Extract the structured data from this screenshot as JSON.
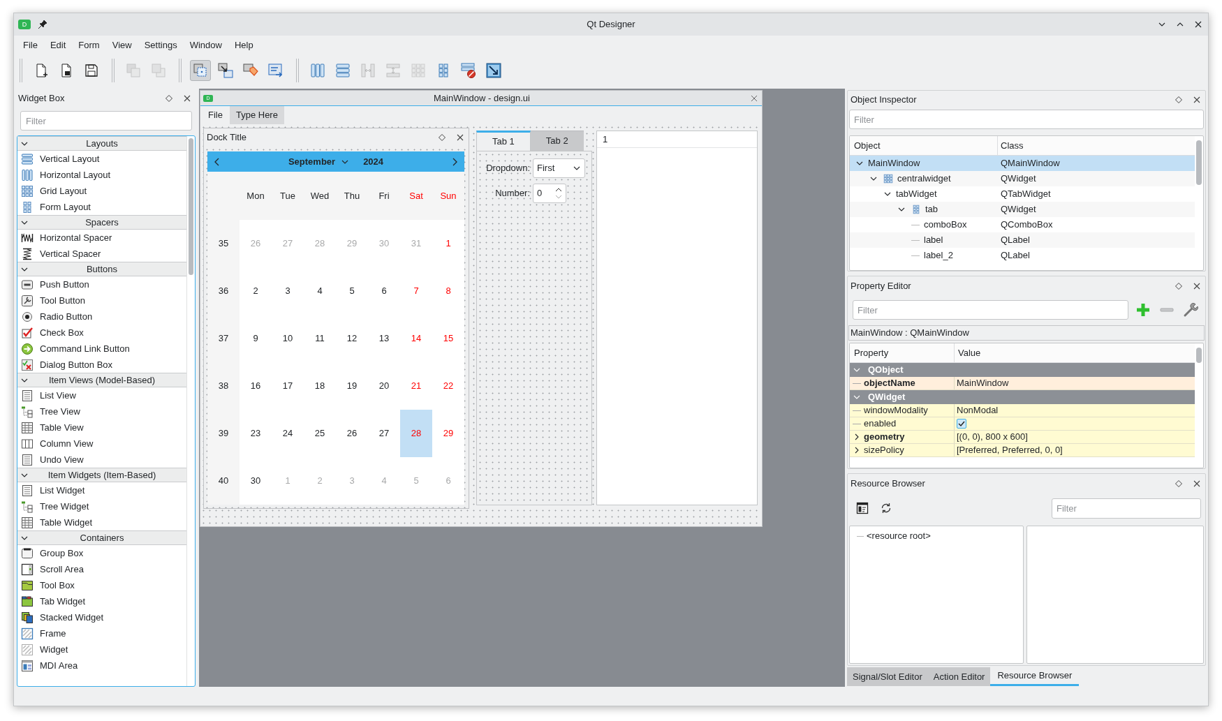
{
  "window": {
    "logo": "D",
    "title": "Qt Designer"
  },
  "menu": [
    "File",
    "Edit",
    "Form",
    "View",
    "Settings",
    "Window",
    "Help"
  ],
  "toolbar_groups": [
    {
      "items": [
        {
          "kind": "new",
          "disabled": false,
          "selected": false
        },
        {
          "kind": "open",
          "disabled": false,
          "selected": false
        },
        {
          "kind": "save",
          "disabled": false,
          "selected": false
        }
      ]
    },
    {
      "items": [
        {
          "kind": "front",
          "disabled": true,
          "selected": false
        },
        {
          "kind": "back",
          "disabled": true,
          "selected": false
        }
      ]
    },
    {
      "items": [
        {
          "kind": "editwidgets",
          "disabled": false,
          "selected": true
        },
        {
          "kind": "signals",
          "disabled": false,
          "selected": false
        },
        {
          "kind": "buddies",
          "disabled": false,
          "selected": false
        },
        {
          "kind": "taborder",
          "disabled": false,
          "selected": false
        }
      ]
    },
    {
      "items": [
        {
          "kind": "hlayout",
          "disabled": false,
          "selected": false
        },
        {
          "kind": "vlayout",
          "disabled": false,
          "selected": false
        },
        {
          "kind": "hsplitter",
          "disabled": true,
          "selected": false
        },
        {
          "kind": "vsplitter",
          "disabled": true,
          "selected": false
        },
        {
          "kind": "grid",
          "disabled": true,
          "selected": false
        },
        {
          "kind": "form",
          "disabled": false,
          "selected": false
        },
        {
          "kind": "breaklayout",
          "disabled": false,
          "selected": false
        },
        {
          "kind": "adjustsize",
          "disabled": false,
          "selected": false
        }
      ]
    }
  ],
  "widget_box": {
    "title": "Widget Box",
    "filter_placeholder": "Filter",
    "categories": [
      {
        "label": "Layouts",
        "expanded": true,
        "items": [
          {
            "label": "Vertical Layout",
            "kind": "vlayout"
          },
          {
            "label": "Horizontal Layout",
            "kind": "hlayout"
          },
          {
            "label": "Grid Layout",
            "kind": "grid"
          },
          {
            "label": "Form Layout",
            "kind": "form"
          }
        ]
      },
      {
        "label": "Spacers",
        "expanded": true,
        "items": [
          {
            "label": "Horizontal Spacer",
            "kind": "hspacer"
          },
          {
            "label": "Vertical Spacer",
            "kind": "vspacer"
          }
        ]
      },
      {
        "label": "Buttons",
        "expanded": true,
        "items": [
          {
            "label": "Push Button",
            "kind": "pushbutton"
          },
          {
            "label": "Tool Button",
            "kind": "toolbutton"
          },
          {
            "label": "Radio Button",
            "kind": "radio"
          },
          {
            "label": "Check Box",
            "kind": "checkbox"
          },
          {
            "label": "Command Link Button",
            "kind": "commandlink"
          },
          {
            "label": "Dialog Button Box",
            "kind": "buttonbox"
          }
        ]
      },
      {
        "label": "Item Views (Model-Based)",
        "expanded": true,
        "items": [
          {
            "label": "List View",
            "kind": "listview"
          },
          {
            "label": "Tree View",
            "kind": "treeview"
          },
          {
            "label": "Table View",
            "kind": "tableview"
          },
          {
            "label": "Column View",
            "kind": "columnview"
          },
          {
            "label": "Undo View",
            "kind": "listview"
          }
        ]
      },
      {
        "label": "Item Widgets (Item-Based)",
        "expanded": true,
        "items": [
          {
            "label": "List Widget",
            "kind": "listview"
          },
          {
            "label": "Tree Widget",
            "kind": "treeview"
          },
          {
            "label": "Table Widget",
            "kind": "tableview"
          }
        ]
      },
      {
        "label": "Containers",
        "expanded": true,
        "items": [
          {
            "label": "Group Box",
            "kind": "groupbox"
          },
          {
            "label": "Scroll Area",
            "kind": "scrollarea"
          },
          {
            "label": "Tool Box",
            "kind": "toolbox"
          },
          {
            "label": "Tab Widget",
            "kind": "tabwidget"
          },
          {
            "label": "Stacked Widget",
            "kind": "stacked"
          },
          {
            "label": "Frame",
            "kind": "frame"
          },
          {
            "label": "Widget",
            "kind": "widget"
          },
          {
            "label": "MDI Area",
            "kind": "mdi"
          }
        ]
      }
    ]
  },
  "form_window": {
    "logo": "D",
    "title": "MainWindow - design.ui",
    "menu": [
      {
        "label": "File",
        "kind": "menu"
      },
      {
        "label": "Type Here",
        "kind": "placeholder"
      }
    ],
    "dock": {
      "title": "Dock Title",
      "calendar": {
        "month": "September",
        "year": "2024",
        "weekdays": [
          {
            "label": "Mon",
            "weekend": false
          },
          {
            "label": "Tue",
            "weekend": false
          },
          {
            "label": "Wed",
            "weekend": false
          },
          {
            "label": "Thu",
            "weekend": false
          },
          {
            "label": "Fri",
            "weekend": false
          },
          {
            "label": "Sat",
            "weekend": true
          },
          {
            "label": "Sun",
            "weekend": true
          }
        ],
        "weeks": [
          {
            "number": "35",
            "days": [
              {
                "day": "26",
                "outside": true,
                "selected": false
              },
              {
                "day": "27",
                "outside": true,
                "selected": false
              },
              {
                "day": "28",
                "outside": true,
                "selected": false
              },
              {
                "day": "29",
                "outside": true,
                "selected": false
              },
              {
                "day": "30",
                "outside": true,
                "selected": false
              },
              {
                "day": "31",
                "outside": true,
                "selected": false
              },
              {
                "day": "1",
                "outside": false,
                "selected": false
              }
            ]
          },
          {
            "number": "36",
            "days": [
              {
                "day": "2",
                "outside": false,
                "selected": false
              },
              {
                "day": "3",
                "outside": false,
                "selected": false
              },
              {
                "day": "4",
                "outside": false,
                "selected": false
              },
              {
                "day": "5",
                "outside": false,
                "selected": false
              },
              {
                "day": "6",
                "outside": false,
                "selected": false
              },
              {
                "day": "7",
                "outside": false,
                "selected": false
              },
              {
                "day": "8",
                "outside": false,
                "selected": false
              }
            ]
          },
          {
            "number": "37",
            "days": [
              {
                "day": "9",
                "outside": false,
                "selected": false
              },
              {
                "day": "10",
                "outside": false,
                "selected": false
              },
              {
                "day": "11",
                "outside": false,
                "selected": false
              },
              {
                "day": "12",
                "outside": false,
                "selected": false
              },
              {
                "day": "13",
                "outside": false,
                "selected": false
              },
              {
                "day": "14",
                "outside": false,
                "selected": false
              },
              {
                "day": "15",
                "outside": false,
                "selected": false
              }
            ]
          },
          {
            "number": "38",
            "days": [
              {
                "day": "16",
                "outside": false,
                "selected": false
              },
              {
                "day": "17",
                "outside": false,
                "selected": false
              },
              {
                "day": "18",
                "outside": false,
                "selected": false
              },
              {
                "day": "19",
                "outside": false,
                "selected": false
              },
              {
                "day": "20",
                "outside": false,
                "selected": false
              },
              {
                "day": "21",
                "outside": false,
                "selected": false
              },
              {
                "day": "22",
                "outside": false,
                "selected": false
              }
            ]
          },
          {
            "number": "39",
            "days": [
              {
                "day": "23",
                "outside": false,
                "selected": false
              },
              {
                "day": "24",
                "outside": false,
                "selected": false
              },
              {
                "day": "25",
                "outside": false,
                "selected": false
              },
              {
                "day": "26",
                "outside": false,
                "selected": false
              },
              {
                "day": "27",
                "outside": false,
                "selected": false
              },
              {
                "day": "28",
                "outside": false,
                "selected": true
              },
              {
                "day": "29",
                "outside": false,
                "selected": false
              }
            ]
          },
          {
            "number": "40",
            "days": [
              {
                "day": "30",
                "outside": false,
                "selected": false
              },
              {
                "day": "1",
                "outside": true,
                "selected": false
              },
              {
                "day": "2",
                "outside": true,
                "selected": false
              },
              {
                "day": "3",
                "outside": true,
                "selected": false
              },
              {
                "day": "4",
                "outside": true,
                "selected": false
              },
              {
                "day": "5",
                "outside": true,
                "selected": false
              },
              {
                "day": "6",
                "outside": true,
                "selected": false
              }
            ]
          }
        ]
      }
    },
    "tab_widget": {
      "tabs": [
        {
          "label": "Tab 1",
          "selected": true
        },
        {
          "label": "Tab 2",
          "selected": false
        }
      ],
      "dropdown": {
        "label": "Dropdown:",
        "value": "First"
      },
      "spinbox": {
        "label": "Number:",
        "value": "0"
      }
    },
    "list_widget": {
      "items": [
        "1"
      ]
    }
  },
  "object_inspector": {
    "title": "Object Inspector",
    "filter_placeholder": "Filter",
    "columns": [
      "Object",
      "Class"
    ],
    "tree": [
      {
        "name": "MainWindow",
        "class": "QMainWindow",
        "expanded": true,
        "selected": true,
        "children": [
          {
            "name": "centralwidget",
            "class": "QWidget",
            "kind": "grid",
            "expanded": true,
            "selected": false,
            "children": [
              {
                "name": "tabWidget",
                "class": "QTabWidget",
                "expanded": true,
                "selected": false,
                "children": [
                  {
                    "name": "tab",
                    "class": "QWidget",
                    "kind": "form",
                    "expanded": true,
                    "selected": false,
                    "children": [
                      {
                        "name": "comboBox",
                        "class": "QComboBox",
                        "selected": false
                      },
                      {
                        "name": "label",
                        "class": "QLabel",
                        "selected": false
                      },
                      {
                        "name": "label_2",
                        "class": "QLabel",
                        "selected": false
                      }
                    ]
                  }
                ]
              }
            ]
          }
        ]
      }
    ]
  },
  "property_editor": {
    "title": "Property Editor",
    "filter_placeholder": "Filter",
    "object_label": "MainWindow : QMainWindow",
    "columns": [
      "Property",
      "Value"
    ],
    "groups": [
      {
        "name": "QObject",
        "expanded": true,
        "color": "#ffefdc",
        "properties": [
          {
            "name": "objectName",
            "value": "MainWindow",
            "modified": true,
            "kind": "text"
          }
        ]
      },
      {
        "name": "QWidget",
        "expanded": true,
        "color": "#fffbd2",
        "properties": [
          {
            "name": "windowModality",
            "value": "NonModal",
            "modified": false,
            "kind": "text"
          },
          {
            "name": "enabled",
            "checked": true,
            "modified": false,
            "kind": "checkbox"
          },
          {
            "name": "geometry",
            "value": "[(0, 0), 800 x 600]",
            "modified": true,
            "kind": "compound",
            "expanded": false
          },
          {
            "name": "sizePolicy",
            "value": "[Preferred, Preferred, 0, 0]",
            "modified": false,
            "kind": "compound",
            "expanded": false
          }
        ]
      }
    ]
  },
  "resource_browser": {
    "title": "Resource Browser",
    "filter_placeholder": "Filter",
    "tree": [
      "<resource root>"
    ]
  },
  "bottom_tabs": [
    {
      "label": "Signal/Slot Editor",
      "selected": false
    },
    {
      "label": "Action Editor",
      "selected": false
    },
    {
      "label": "Resource Browser",
      "selected": true
    }
  ]
}
